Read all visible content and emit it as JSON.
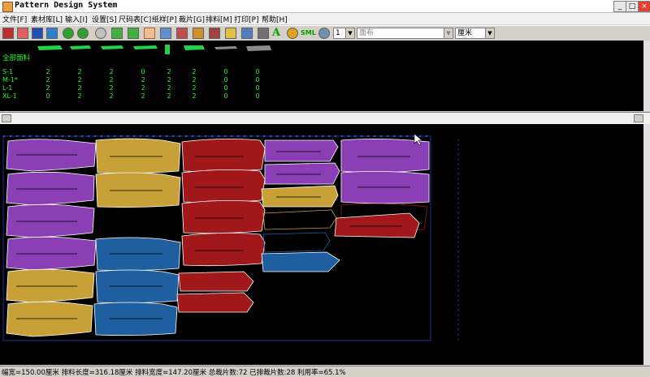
{
  "window": {
    "title": "Pattern Design System",
    "min": "_",
    "max": "□",
    "close": "×"
  },
  "menu": [
    "文件[F]",
    "素材库[L]",
    "输入[I]",
    "设置[S]",
    "尺码表[C]",
    "纸样[P]",
    "裁片[G]",
    "排料[M]",
    "打印[P]",
    "帮助[H]"
  ],
  "toolbar": {
    "sml_label": "SML",
    "combo_num": "1",
    "combo_fabric": "面布",
    "combo_unit": "厘米"
  },
  "fabric": {
    "label": "全部面料",
    "sizes": [
      {
        "name": "S-1",
        "counts": [
          "2",
          "2",
          "2",
          "0",
          "2",
          "2",
          "0",
          "0"
        ]
      },
      {
        "name": "M-1*",
        "counts": [
          "2",
          "2",
          "2",
          "2",
          "2",
          "2",
          "0",
          "0"
        ]
      },
      {
        "name": "L-1",
        "counts": [
          "2",
          "2",
          "2",
          "2",
          "2",
          "2",
          "0",
          "0"
        ]
      },
      {
        "name": "XL-1",
        "counts": [
          "0",
          "2",
          "2",
          "2",
          "2",
          "2",
          "0",
          "0"
        ]
      }
    ]
  },
  "pieces_colors": {
    "purple": "#8a3fb5",
    "gold": "#c7a037",
    "red": "#a0181a",
    "blue": "#1f5fa0",
    "grey": "#8c8c8c",
    "green": "#23d34a"
  },
  "status": "幅宽=150.00厘米 排料长度=316.18厘米 排料宽度=147.20厘米 总裁片数:72 已排裁片数:28 利用率=65.1%"
}
